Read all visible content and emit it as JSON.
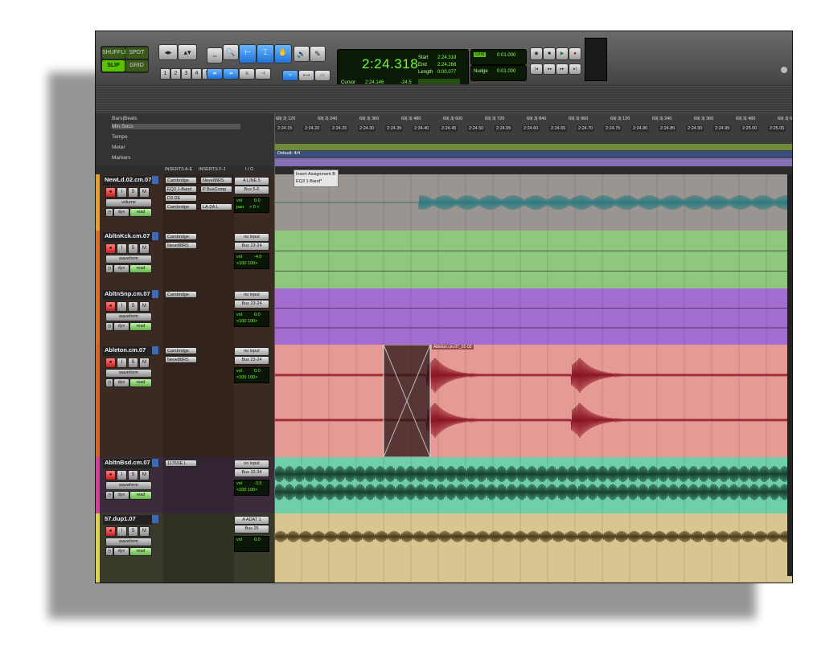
{
  "toolbar": {
    "modes": {
      "shuffle": "SHUFFLE",
      "spot": "SPOT",
      "slip": "SLIP",
      "grid": "GRID"
    },
    "zoom_presets": [
      "1",
      "2",
      "3",
      "4",
      "5"
    ],
    "counter": {
      "main": "2:24.318",
      "start_label": "Start",
      "start_value": "2:24.318",
      "end_label": "End",
      "end_value": "2:24.266",
      "length_label": "Length",
      "length_value": "0:00.077",
      "cursor_label": "Cursor",
      "cursor_value": "2:24.146",
      "extra_value": "-24.5"
    },
    "grid_label": "Grid",
    "nudge_label": "Nudge",
    "grid_value": "0:01.000",
    "nudge_value": "0:01.000"
  },
  "rulers": {
    "bars_beats": "Bars|Beats",
    "min_secs": "Min:Secs",
    "tempo": "Tempo",
    "meter": "Meter",
    "markers": "Markers",
    "meter_value": "Default: 4/4",
    "bar_ticks": [
      "68| 2| 120",
      "69| 2| 240",
      "69| 3| 360",
      "69| 3| 480",
      "69| 3| 600",
      "69| 3| 720",
      "69| 3| 840",
      "69| 3| 960",
      "69| 3| 120",
      "69| 3| 240",
      "69| 3| 360",
      "69| 3| 480",
      "69| 3| 600"
    ],
    "time_ticks": [
      "2:24.15",
      "2:24.20",
      "2:24.25",
      "2:24.30",
      "2:24.35",
      "2:24.40",
      "2:24.45",
      "2:24.50",
      "2:24.55",
      "2:24.60",
      "2:24.65",
      "2:24.70",
      "2:24.75",
      "2:24.80",
      "2:24.85",
      "2:24.90",
      "2:24.95",
      "2:25.00",
      "2:25.05"
    ]
  },
  "mix_header": {
    "inserts_ae": "INSERTS A-E",
    "inserts_fj": "INSERTS F-J",
    "io": "I / O"
  },
  "tooltip": {
    "line1": "Insert Assignment B",
    "line2": "EQ3 1-Band*"
  },
  "tracks": [
    {
      "name": "NewLd.02.cm.07",
      "color": "#e6a321",
      "view": "volume",
      "auto": "read",
      "dyn": "dyn",
      "inserts_a": [
        "Cambridge",
        "EQ3 1-Band",
        "D3 DE",
        "Cambridge"
      ],
      "inserts_b": [
        "Neve88RS",
        "P BusComp",
        "",
        "LA-2A L"
      ],
      "io": [
        "A LINE 5",
        "Bus 5-6"
      ],
      "vol": "0.0",
      "pan": "> 0 <",
      "vol_label": "vol",
      "pan_label": "pan",
      "lane_color": "#9a9590"
    },
    {
      "name": "AbltnKck.cm.07",
      "color": "#e06b1b",
      "view": "waveform",
      "auto": "read",
      "dyn": "dyn",
      "inserts_a": [
        "Cambridge",
        "Neve88RS"
      ],
      "inserts_b": [],
      "io": [
        "no input",
        "Bus 23-24"
      ],
      "vol": "-4.0",
      "pan": "<100  100>",
      "vol_label": "vol",
      "lane_color": "#8fc77e"
    },
    {
      "name": "AbltnSnp.cm.07",
      "color": "#e06b1b",
      "view": "waveform",
      "auto": "read",
      "dyn": "dyn",
      "inserts_a": [
        "Cambridge"
      ],
      "inserts_b": [],
      "io": [
        "no input",
        "Bus 23-24"
      ],
      "vol": "0.0",
      "pan": "<100  100>",
      "vol_label": "vol",
      "lane_color": "#a36dd0"
    },
    {
      "name": "Ableton.cm.07",
      "color": "#e0631b",
      "view": "waveform",
      "auto": "read",
      "dyn": "dyn",
      "inserts_a": [
        "Cambridge",
        "Neve88RS"
      ],
      "inserts_b": [],
      "io": [
        "no input",
        "Bus 23-24"
      ],
      "vol": "0.0",
      "pan": "<100  100>",
      "vol_label": "vol",
      "lane_color": "#e59a96",
      "clip_name": "Ableton.cm.07_01-02"
    },
    {
      "name": "AbltnBsd.cm.07",
      "color": "#d83ca0",
      "view": "waveform",
      "auto": "read",
      "dyn": "dyn",
      "inserts_a": [
        "1176SE L"
      ],
      "inserts_b": [],
      "io": [
        "no input",
        "Bus 33-34"
      ],
      "vol": "-3.5",
      "pan": "<100  100>",
      "vol_label": "vol",
      "lane_color": "#6ecfa8"
    },
    {
      "name": "57.dup1.07",
      "color": "#d8d83c",
      "view": "waveform",
      "auto": "read",
      "dyn": "dyn",
      "inserts_a": [],
      "inserts_b": [],
      "io": [
        "A ADAT 1",
        "Bus 25"
      ],
      "vol": "0.0",
      "vol_label": "vol",
      "lane_color": "#d8c690"
    }
  ]
}
